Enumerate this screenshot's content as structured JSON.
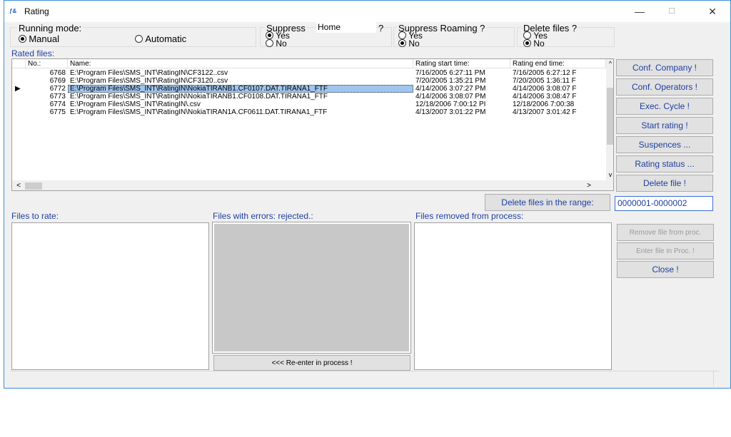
{
  "window": {
    "title": "Rating",
    "icon": "rating-app-icon",
    "controls": {
      "minimize": "—",
      "maximize": "☐",
      "close": "✕"
    }
  },
  "running_mode": {
    "label": "Running mode:",
    "options": [
      {
        "label": "Manual",
        "selected": true
      },
      {
        "label": "Automatic",
        "selected": false
      }
    ]
  },
  "suppress_home": {
    "label": "Suppress",
    "input_value": "Home",
    "question": "?",
    "options": [
      {
        "label": "Yes",
        "selected": true
      },
      {
        "label": "No",
        "selected": false
      }
    ]
  },
  "suppress_roaming": {
    "label": "Suppress Roaming ?",
    "options": [
      {
        "label": "Yes",
        "selected": false
      },
      {
        "label": "No",
        "selected": true
      }
    ]
  },
  "delete_files": {
    "label": "Delete files ?",
    "options": [
      {
        "label": "Yes",
        "selected": false
      },
      {
        "label": "No",
        "selected": true
      }
    ]
  },
  "rated_files": {
    "label": "Rated files:",
    "columns": [
      "No.:",
      "Name:",
      "Rating start time:",
      "Rating end time:"
    ],
    "rows": [
      {
        "indicator": "",
        "no": "6768",
        "name": "E:\\Program Files\\SMS_INT\\RatingIN\\CF3122..csv",
        "start": "7/16/2005 6:27:11 PM",
        "end": "7/16/2005 6:27:12 F"
      },
      {
        "indicator": "",
        "no": "6769",
        "name": "E:\\Program Files\\SMS_INT\\RatingIN\\CF3120..csv",
        "start": "7/20/2005 1:35:21 PM",
        "end": "7/20/2005 1:36:11 F"
      },
      {
        "indicator": "▶",
        "no": "6772",
        "name": "E:\\Program Files\\SMS_INT\\RatingIN\\NokiaTIRANB1.CF0107.DAT.TIRANA1_FTF",
        "start": "4/14/2006 3:07:27 PM",
        "end": "4/14/2006 3:08:07 F"
      },
      {
        "indicator": "",
        "no": "6773",
        "name": "E:\\Program Files\\SMS_INT\\RatingIN\\NokiaTIRANB1.CF0108.DAT.TIRANA1_FTF",
        "start": "4/14/2006 3:08:07 PM",
        "end": "4/14/2006 3:08:47 F"
      },
      {
        "indicator": "",
        "no": "6774",
        "name": "E:\\Program Files\\SMS_INT\\RatingIN\\.csv",
        "start": "12/18/2006 7:00:12 PI",
        "end": "12/18/2006 7:00:38"
      },
      {
        "indicator": "",
        "no": "6775",
        "name": "E:\\Program Files\\SMS_INT\\RatingIN\\NokiaTIRAN1A.CF0611.DAT.TIRANA1_FTF",
        "start": "4/13/2007 3:01:22 PM",
        "end": "4/13/2007 3:01:42 F"
      }
    ],
    "scroll": {
      "up": "^",
      "down": "v",
      "left": "<",
      "right": ">"
    }
  },
  "buttons": {
    "conf_company": "Conf. Company !",
    "conf_operators": "Conf. Operators !",
    "exec_cycle": "Exec. Cycle !",
    "start_rating": "Start rating !",
    "suspences": "Suspences ...",
    "rating_status": "Rating status ...",
    "delete_file": "Delete file !",
    "delete_range": "Delete files in the range:",
    "remove_from_proc": "Remove file from proc.",
    "enter_in_proc": "Enter file in Proc. !",
    "close": "Close !",
    "reenter": "<<<  Re-enter in process !"
  },
  "range_value": "0000001-0000002",
  "lists": {
    "to_rate": "Files to rate:",
    "errors": "Files with errors: rejected.:",
    "removed": "Files removed from process:"
  }
}
